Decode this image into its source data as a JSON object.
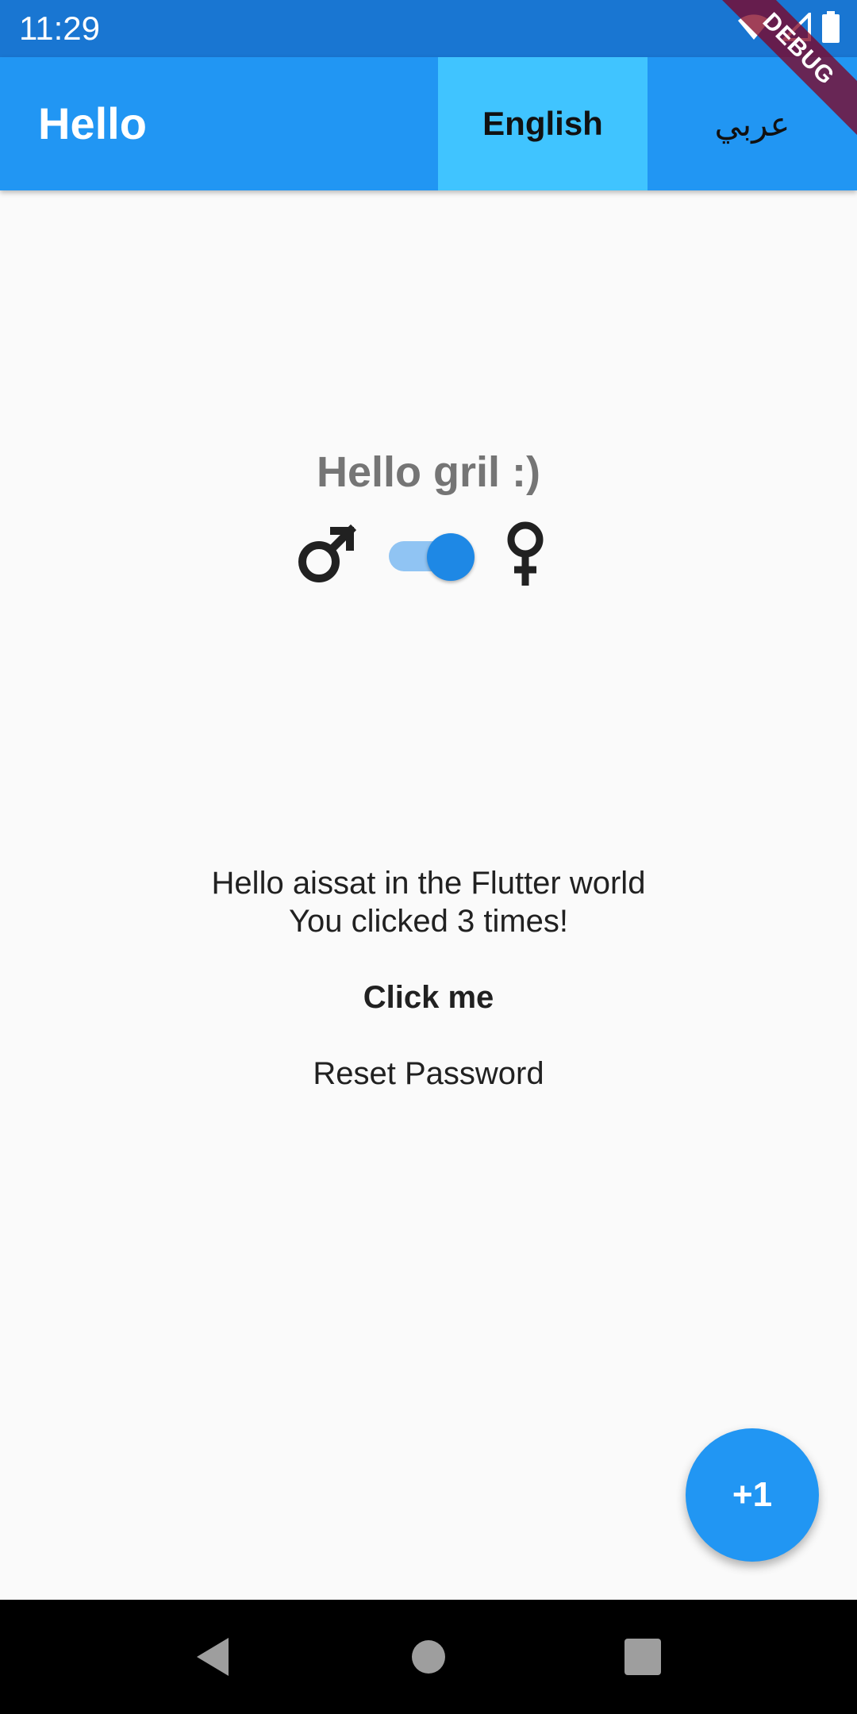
{
  "status_bar": {
    "time": "11:29",
    "icons": [
      "wifi-icon",
      "signal-icon",
      "battery-icon"
    ]
  },
  "debug_banner": {
    "label": "DEBUG"
  },
  "app_bar": {
    "title": "Hello",
    "languages": [
      {
        "label": "English",
        "selected": true
      },
      {
        "label": "عربي",
        "selected": false
      }
    ]
  },
  "main": {
    "greeting": "Hello gril :)",
    "gender_switch": {
      "left_icon": "male-icon",
      "right_icon": "female-icon",
      "on": true
    },
    "info_lines": [
      "Hello aissat in the Flutter world",
      "You clicked 3 times!"
    ],
    "click_button_label": "Click me",
    "reset_button_label": "Reset Password"
  },
  "fab": {
    "label": "+1"
  },
  "nav_bar": {
    "icons": [
      "back-icon",
      "home-icon",
      "recent-apps-icon"
    ]
  },
  "colors": {
    "status_bar": "#1976d2",
    "app_bar": "#2196f3",
    "selected_language": "#40c4ff",
    "switch_thumb": "#1e88e5",
    "switch_track": "#90c4f3",
    "fab": "#2196f3",
    "greeting_text": "#757575"
  }
}
